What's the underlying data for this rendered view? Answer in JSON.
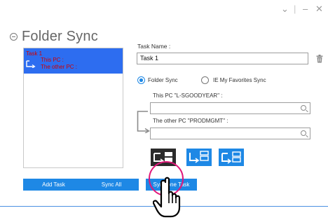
{
  "window": {
    "controls": {
      "minimize_chevron": "⌄",
      "separator": "|",
      "minimize": "–",
      "close": "✕"
    }
  },
  "header": {
    "title": "Folder Sync"
  },
  "task_list": {
    "items": [
      {
        "name": "Task 1",
        "line1": "This PC :",
        "line2": "The other PC :",
        "selected": true
      }
    ]
  },
  "form": {
    "task_name_label": "Task Name :",
    "task_name_value": "Task 1",
    "sync_options": [
      {
        "label": "Folder Sync",
        "selected": true
      },
      {
        "label": "IE My Favorites Sync",
        "selected": false
      }
    ],
    "this_pc_label": "This PC \"L-SGOODYEAR\" :",
    "this_pc_value": "",
    "other_pc_label": "The other PC \"PRODMGMT\" :",
    "other_pc_value": ""
  },
  "buttons": {
    "add_task": "Add Task",
    "sync_all": "Sync All",
    "sync_one_task": "Sync one Task"
  },
  "colors": {
    "accent_blue": "#1e88e5",
    "selection_blue": "#2d6df0",
    "task_text_red": "#d00000",
    "mode_dark": "#2b2b2b",
    "highlight_pink": "#e0187a"
  }
}
